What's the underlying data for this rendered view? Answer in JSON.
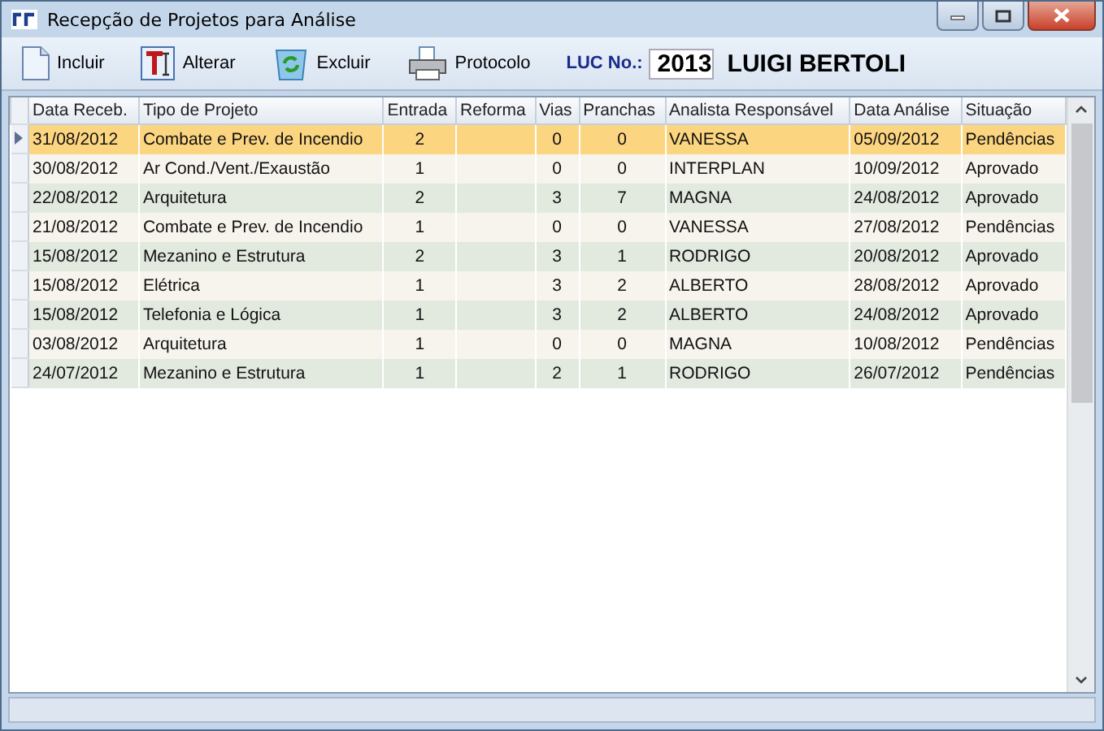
{
  "window": {
    "title": "Recepção de Projetos para Análise"
  },
  "toolbar": {
    "buttons": [
      {
        "label": "Incluir",
        "kind": "document"
      },
      {
        "label": "Alterar",
        "kind": "text"
      },
      {
        "label": "Excluir",
        "kind": "recycle"
      },
      {
        "label": "Protocolo",
        "kind": "printer"
      }
    ],
    "luc_label": "LUC No.:",
    "luc_value": "2013",
    "owner": "LUIGI BERTOLI"
  },
  "table": {
    "columns": [
      "Data Receb.",
      "Tipo de Projeto",
      "Entrada",
      "Reforma",
      "Vias",
      "Pranchas",
      "Analista Responsável",
      "Data Análise",
      "Situação"
    ],
    "rows": [
      {
        "selected": true,
        "cells": [
          "31/08/2012",
          "Combate e Prev. de Incendio",
          "2",
          "",
          "0",
          "0",
          "VANESSA",
          "05/09/2012",
          "Pendências"
        ]
      },
      {
        "selected": false,
        "cells": [
          "30/08/2012",
          "Ar Cond./Vent./Exaustão",
          "1",
          "",
          "0",
          "0",
          "INTERPLAN",
          "10/09/2012",
          "Aprovado"
        ]
      },
      {
        "selected": false,
        "cells": [
          "22/08/2012",
          "Arquitetura",
          "2",
          "",
          "3",
          "7",
          "MAGNA",
          "24/08/2012",
          "Aprovado"
        ]
      },
      {
        "selected": false,
        "cells": [
          "21/08/2012",
          "Combate e Prev. de Incendio",
          "1",
          "",
          "0",
          "0",
          "VANESSA",
          "27/08/2012",
          "Pendências"
        ]
      },
      {
        "selected": false,
        "cells": [
          "15/08/2012",
          "Mezanino e Estrutura",
          "2",
          "",
          "3",
          "1",
          "RODRIGO",
          "20/08/2012",
          "Aprovado"
        ]
      },
      {
        "selected": false,
        "cells": [
          "15/08/2012",
          "Elétrica",
          "1",
          "",
          "3",
          "2",
          "ALBERTO",
          "28/08/2012",
          "Aprovado"
        ]
      },
      {
        "selected": false,
        "cells": [
          "15/08/2012",
          "Telefonia e Lógica",
          "1",
          "",
          "3",
          "2",
          "ALBERTO",
          "24/08/2012",
          "Aprovado"
        ]
      },
      {
        "selected": false,
        "cells": [
          "03/08/2012",
          "Arquitetura",
          "1",
          "",
          "0",
          "0",
          "MAGNA",
          "10/08/2012",
          "Pendências"
        ]
      },
      {
        "selected": false,
        "cells": [
          "24/07/2012",
          "Mezanino e Estrutura",
          "1",
          "",
          "2",
          "1",
          "RODRIGO",
          "26/07/2012",
          "Pendências"
        ]
      }
    ]
  }
}
